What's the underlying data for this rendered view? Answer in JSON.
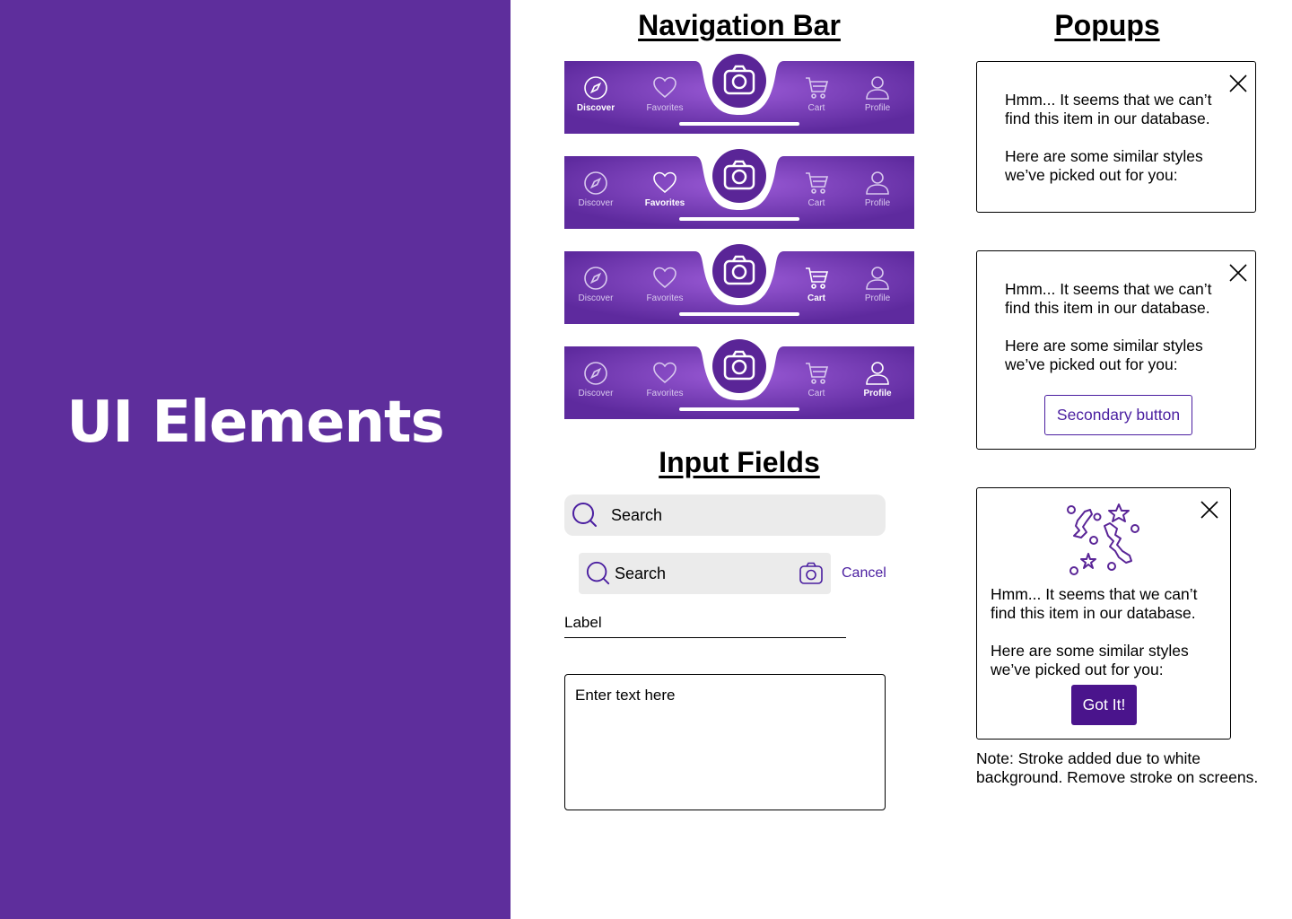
{
  "hero": {
    "title": "UI Elements"
  },
  "sections": {
    "navigation_bar": "Navigation Bar",
    "input_fields": "Input Fields",
    "popups": "Popups"
  },
  "navbars": [
    {
      "active": "discover",
      "items": {
        "discover": "Discover",
        "favorites": "Favorites",
        "cart": "Cart",
        "profile": "Profile"
      }
    },
    {
      "active": "favorites",
      "items": {
        "discover": "Discover",
        "favorites": "Favorites",
        "cart": "Cart",
        "profile": "Profile"
      }
    },
    {
      "active": "cart",
      "items": {
        "discover": "Discover",
        "favorites": "Favorites",
        "cart": "Cart",
        "profile": "Profile"
      }
    },
    {
      "active": "profile",
      "items": {
        "discover": "Discover",
        "favorites": "Favorites",
        "cart": "Cart",
        "profile": "Profile"
      }
    }
  ],
  "inputs": {
    "search_default": "Search",
    "search_active": "Search",
    "cancel_label": "Cancel",
    "label_field": "Label",
    "textarea_placeholder": "Enter text here"
  },
  "popups": [
    {
      "line1": "Hmm... It seems that we can’t find this item in our database.",
      "line2": "Here are some similar styles we’ve picked out for you:"
    },
    {
      "line1": "Hmm... It seems that we can’t find this item in our database.",
      "line2": "Here are some similar styles we’ve picked out for you:",
      "button": "Secondary button"
    },
    {
      "line1": "Hmm... It seems that we can’t find this item in our database.",
      "line2": "Here are some similar styles we’ve picked out for you:",
      "button": "Got It!"
    }
  ],
  "note": "Note: Stroke added due to white background. Remove stroke on screens.",
  "colors": {
    "left_panel": "#5e2e9c",
    "nav_gradient_start": "#5e2a9e",
    "nav_gradient_mid": "#9a5ad6",
    "camera_button": "#5a2597",
    "accent": "#4a1ea0",
    "primary_button": "#4a148c",
    "input_background": "#ebebeb"
  },
  "icons": [
    "compass-icon",
    "heart-icon",
    "camera-icon",
    "cart-icon",
    "profile-icon",
    "search-icon",
    "close-icon",
    "confetti-icon"
  ]
}
